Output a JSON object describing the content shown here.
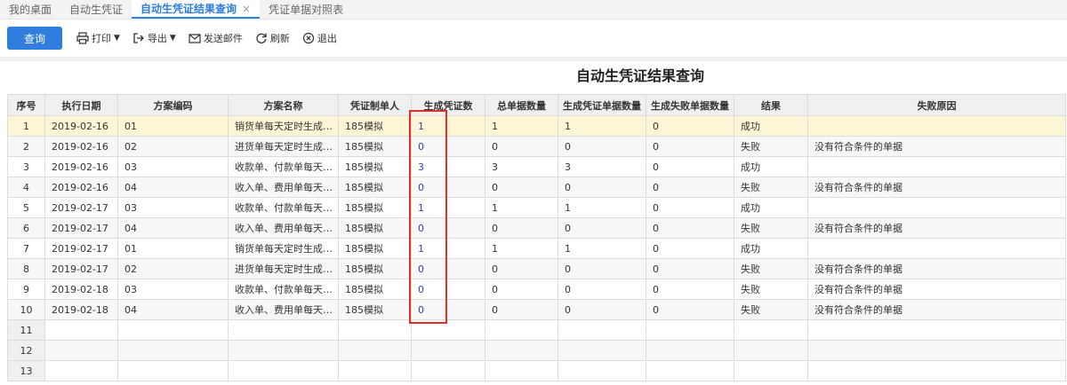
{
  "tabs": [
    {
      "label": "我的桌面",
      "active": false
    },
    {
      "label": "自动生凭证",
      "active": false
    },
    {
      "label": "自动生凭证结果查询",
      "active": true,
      "close": "×"
    },
    {
      "label": "凭证单据对照表",
      "active": false
    }
  ],
  "toolbar": {
    "query_label": "查询",
    "print_label": "打印",
    "export_label": "导出",
    "email_label": "发送邮件",
    "refresh_label": "刷新",
    "exit_label": "退出"
  },
  "report_title": "自动生凭证结果查询",
  "table": {
    "columns": [
      "序号",
      "执行日期",
      "方案编码",
      "方案名称",
      "凭证制单人",
      "生成凭证数",
      "总单据数量",
      "生成凭证单据数量",
      "生成失败单据数量",
      "结果",
      "失败原因"
    ],
    "rows": [
      [
        "1",
        "2019-02-16",
        "01",
        "销货单每天定时生成…",
        "185模拟",
        "1",
        "1",
        "1",
        "0",
        "成功",
        ""
      ],
      [
        "2",
        "2019-02-16",
        "02",
        "进货单每天定时生成…",
        "185模拟",
        "0",
        "0",
        "0",
        "0",
        "失败",
        "没有符合条件的单据"
      ],
      [
        "3",
        "2019-02-16",
        "03",
        "收款单、付款单每天…",
        "185模拟",
        "3",
        "3",
        "3",
        "0",
        "成功",
        ""
      ],
      [
        "4",
        "2019-02-16",
        "04",
        "收入单、费用单每天…",
        "185模拟",
        "0",
        "0",
        "0",
        "0",
        "失败",
        "没有符合条件的单据"
      ],
      [
        "5",
        "2019-02-17",
        "03",
        "收款单、付款单每天…",
        "185模拟",
        "1",
        "1",
        "1",
        "0",
        "成功",
        ""
      ],
      [
        "6",
        "2019-02-17",
        "04",
        "收入单、费用单每天…",
        "185模拟",
        "0",
        "0",
        "0",
        "0",
        "失败",
        "没有符合条件的单据"
      ],
      [
        "7",
        "2019-02-17",
        "01",
        "销货单每天定时生成…",
        "185模拟",
        "1",
        "1",
        "1",
        "0",
        "成功",
        ""
      ],
      [
        "8",
        "2019-02-17",
        "02",
        "进货单每天定时生成…",
        "185模拟",
        "0",
        "0",
        "0",
        "0",
        "失败",
        "没有符合条件的单据"
      ],
      [
        "9",
        "2019-02-18",
        "03",
        "收款单、付款单每天…",
        "185模拟",
        "0",
        "0",
        "0",
        "0",
        "失败",
        "没有符合条件的单据"
      ],
      [
        "10",
        "2019-02-18",
        "04",
        "收入单、费用单每天…",
        "185模拟",
        "0",
        "0",
        "0",
        "0",
        "失败",
        "没有符合条件的单据"
      ]
    ],
    "empty_rows": [
      "11",
      "12",
      "13"
    ]
  },
  "colors": {
    "accent": "#2f7ddc",
    "highlight": "#e0302b",
    "selected_row": "#fdf6d6"
  }
}
